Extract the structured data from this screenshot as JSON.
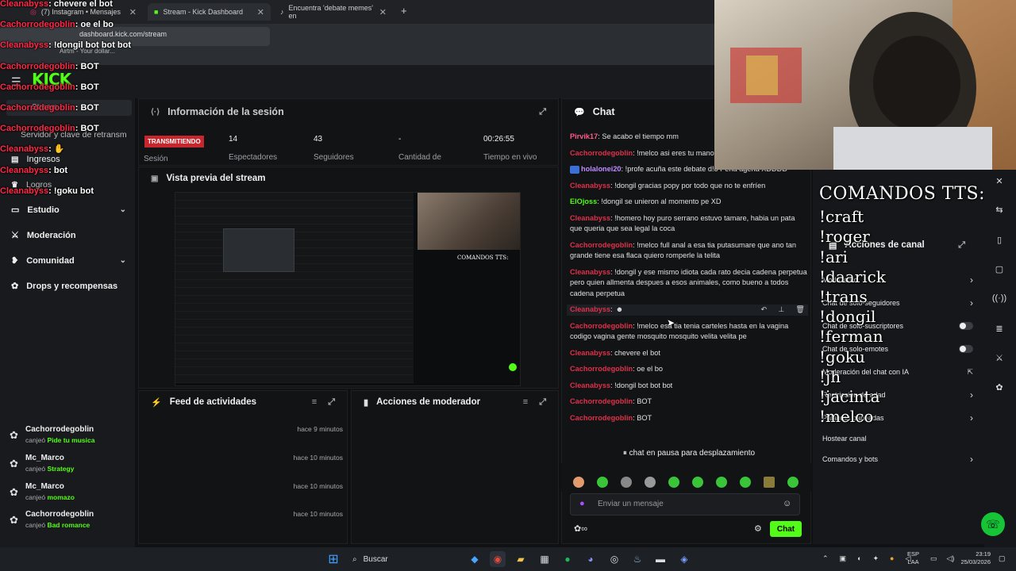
{
  "browser": {
    "tabs": [
      {
        "label": "(7) Instagram • Mensajes"
      },
      {
        "label": "Stream - Kick Dashboard"
      },
      {
        "label": "Encuentra 'debate memes' en"
      }
    ],
    "url": "dashboard.kick.com/stream",
    "bookmark": "Airtm - Your dollar..."
  },
  "brand": {
    "logo": "KICK"
  },
  "sidebar": {
    "items": [
      {
        "label": "Stream"
      },
      {
        "label": "Servidor y clave de retransm"
      },
      {
        "label": "Ingresos"
      },
      {
        "label": "Logros"
      },
      {
        "label": "Estudio"
      },
      {
        "label": "Moderación"
      },
      {
        "label": "Comunidad"
      },
      {
        "label": "Drops y recompensas"
      }
    ]
  },
  "session": {
    "title": "Información de la sesión",
    "live_badge": "TRANSMITIENDO",
    "live_label": "Sesión",
    "stats": [
      {
        "value": "14",
        "label": "Espectadores"
      },
      {
        "value": "43",
        "label": "Seguidores"
      },
      {
        "value": "-",
        "label": "Cantidad de"
      },
      {
        "value": "00:26:55",
        "label": "Tiempo en vivo"
      }
    ]
  },
  "preview": {
    "title": "Vista previa del stream"
  },
  "feed": {
    "title": "Feed de actividades",
    "items": [
      {
        "name": "Cachorrodegoblin",
        "action": "canjeó",
        "reward": "Pide tu musica",
        "time": "hace 9 minutos"
      },
      {
        "name": "Mc_Marco",
        "action": "canjeó",
        "reward": "Strategy",
        "time": "hace 10 minutos"
      },
      {
        "name": "Mc_Marco",
        "action": "canjeó",
        "reward": "momazo",
        "time": "hace 10 minutos"
      },
      {
        "name": "Cachorrodegoblin",
        "action": "canjeó",
        "reward": "Bad romance",
        "time": "hace 10 minutos"
      }
    ]
  },
  "mod_actions": {
    "title": "Acciones de moderador"
  },
  "chat": {
    "title": "Chat",
    "messages": [
      {
        "user": "Pirvik17",
        "text": ": Se acabo el tiempo mm",
        "color": "#ff5a8a"
      },
      {
        "user": "Cachorrodegoblin",
        "text": ": !melco asi eres tu mano de mierda",
        "color": "#e0304a"
      },
      {
        "user": "holalonei20",
        "text": ": !profe acuña este debate d!o Pena agena XDDDD",
        "color": "#c08bff"
      },
      {
        "user": "Cleanabyss",
        "text": ": !dongil gracias popy por todo que no te enfríen",
        "color": "#e0304a"
      },
      {
        "user": "ElOjoss",
        "text": ": !dongil se unieron al momento pe XD",
        "color": "#53fc18"
      },
      {
        "user": "Cleanabyss",
        "text": ": !homero hoy puro serrano estuvo tamare, habia un pata que queria que sea legal la coca",
        "color": "#e0304a"
      },
      {
        "user": "Cachorrodegoblin",
        "text": ": !melco full anal a esa tia putasumare que ano tan grande tiene esa flaca quiero romperle la telita",
        "color": "#e0304a"
      },
      {
        "user": "Cleanabyss",
        "text": ": !dongil y ese mismo idiota cada rato decia cadena perpetua pero quien allmenta despues a esos animales, como bueno a todos cadena perpetua",
        "color": "#e0304a"
      },
      {
        "user": "Cleanabyss",
        "text": ":",
        "color": "#e0304a"
      },
      {
        "user": "Cachorrodegoblin",
        "text": ": !melco esa tia tenia carteles hasta en la vagina codigo vagina gente mosquito mosquito velita velita pe",
        "color": "#e0304a"
      },
      {
        "user": "Cleanabyss",
        "text": ": chevere el bot",
        "color": "#e0304a"
      },
      {
        "user": "Cachorrodegoblin",
        "text": ": oe el bo",
        "color": "#e0304a"
      },
      {
        "user": "Cleanabyss",
        "text": ": !dongil bot bot bot",
        "color": "#e0304a"
      },
      {
        "user": "Cachorrodegoblin",
        "text": ": BOT",
        "color": "#e0304a"
      },
      {
        "user": "Cachorrodegoblin",
        "text": ": BOT",
        "color": "#e0304a"
      }
    ],
    "paused": "chat en pausa para desplazamiento",
    "input_placeholder": "Enviar un mensaje",
    "send_label": "Chat"
  },
  "overlay_chat": [
    {
      "user": "Cleanabyss",
      "text": "chevere el bot"
    },
    {
      "user": "Cachorrodegoblin",
      "text": "oe el bo"
    },
    {
      "user": "Cleanabyss",
      "text": "!dongil bot bot bot"
    },
    {
      "user": "Cachorrodegoblin",
      "text": "BOT"
    },
    {
      "user": "Cachorrodegoblin",
      "text": "BOT"
    },
    {
      "user": "Cachorrodegoblin",
      "text": "BOT"
    },
    {
      "user": "Cachorrodegoblin",
      "text": "BOT"
    },
    {
      "user": "Cleanabyss",
      "text": ""
    },
    {
      "user": "Cleanabyss",
      "text": "bot"
    },
    {
      "user": "Cleanabyss",
      "text": "!goku bot"
    }
  ],
  "tts": {
    "heading": "COMANDOS TTS:",
    "commands": [
      "!craft",
      "!roger",
      "!ari",
      "!daarick",
      "!trans",
      "!dongil",
      "!ferman",
      "!goku",
      "!jh",
      "!jacinta",
      "!melco"
    ]
  },
  "channel_actions": {
    "title": "Acciones de canal",
    "rows": [
      {
        "label": "Modo lento",
        "control": "arrow"
      },
      {
        "label": "Chat de solo-seguidores",
        "control": "arrow"
      },
      {
        "label": "Chat de solo-suscriptores",
        "control": "toggle"
      },
      {
        "label": "Chat de solo-emotes",
        "control": "toggle"
      },
      {
        "label": "Moderación del chat con IA",
        "control": "link"
      },
      {
        "label": "Restricción de edad",
        "control": "arrow"
      },
      {
        "label": "Palabras baneadas",
        "control": "arrow"
      },
      {
        "label": "Hostear canal",
        "control": "none"
      },
      {
        "label": "Comandos y bots",
        "control": "arrow"
      }
    ]
  },
  "taskbar": {
    "search": "Buscar",
    "lang": "ESP",
    "lang2": "LAA",
    "time": "23:19",
    "date": "25/03/2026"
  },
  "colors": {
    "accent": "#53fc18",
    "live": "#c9252c",
    "username_red": "#e0304a"
  }
}
